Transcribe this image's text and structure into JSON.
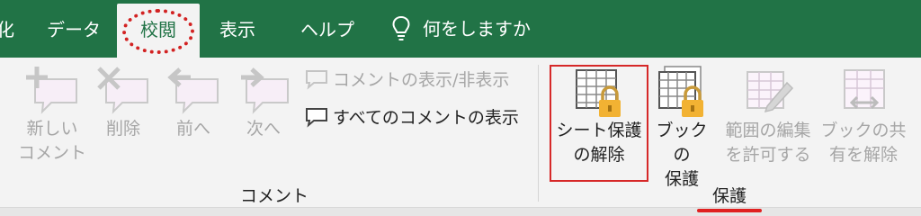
{
  "tabs": {
    "cut": "化",
    "data": "データ",
    "review": "校閲",
    "view": "表示",
    "help": "ヘルプ",
    "search": "何をしますか"
  },
  "comments_group": {
    "label": "コメント",
    "new_comment": [
      "新しい",
      "コメント"
    ],
    "delete": "削除",
    "previous": "前へ",
    "next": "次へ",
    "toggle_comment": "コメントの表示/非表示",
    "show_all": "すべてのコメントの表示"
  },
  "protect_group": {
    "label": "保護",
    "unprotect_sheet": [
      "シート保護",
      "の解除"
    ],
    "protect_workbook": [
      "ブックの",
      "保護"
    ],
    "allow_edit_ranges": [
      "範囲の編集",
      "を許可する"
    ],
    "unshare_workbook": [
      "ブックの共",
      "有を解除"
    ]
  },
  "colors": {
    "accent": "#217346",
    "highlight": "#d62828",
    "disabled": "#a6a6a6"
  }
}
